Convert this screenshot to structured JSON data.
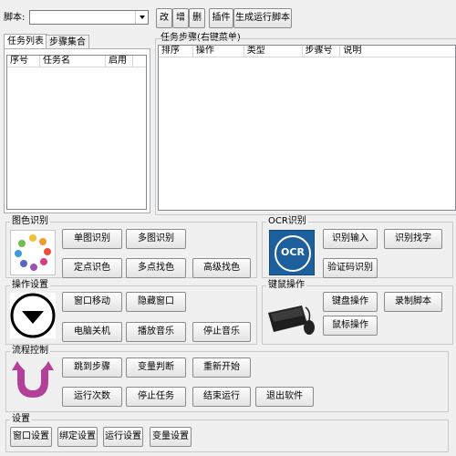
{
  "toolbar": {
    "script_label": "脚本:",
    "script_select_value": "",
    "btn_edit": "改",
    "btn_add": "增",
    "btn_delete": "删",
    "btn_plugin": "插件",
    "btn_generate": "生成运行脚本"
  },
  "left_tabs": {
    "task_list": "任务列表",
    "step_set": "步骤集合"
  },
  "task_list": {
    "columns": [
      "序号",
      "任务名",
      "启用"
    ]
  },
  "task_steps": {
    "title": "任务步骤(右键菜单)",
    "columns": [
      "排序",
      "操作",
      "类型",
      "步骤号",
      "说明"
    ]
  },
  "color_group": {
    "title": "图色识别",
    "buttons": [
      "单图识别",
      "多图识别",
      "定点识色",
      "多点找色",
      "高级找色"
    ]
  },
  "ocr_group": {
    "title": "OCR识别",
    "icon_text": "OCR",
    "buttons": [
      "识别输入",
      "识别找字",
      "验证码识别"
    ]
  },
  "op_group": {
    "title": "操作设置",
    "buttons": [
      "窗口移动",
      "隐藏窗口",
      "电脑关机",
      "播放音乐",
      "停止音乐"
    ]
  },
  "km_group": {
    "title": "键鼠操作",
    "buttons": [
      "键盘操作",
      "录制脚本",
      "鼠标操作"
    ]
  },
  "flow_group": {
    "title": "流程控制",
    "buttons": [
      "跳到步骤",
      "变量判断",
      "重新开始",
      "运行次数",
      "停止任务",
      "结束运行",
      "退出软件"
    ]
  },
  "settings_group": {
    "title": "设置",
    "buttons": [
      "窗口设置",
      "绑定设置",
      "运行设置",
      "变量设置"
    ]
  },
  "colors": {
    "accent_blue": "#1d5f9c",
    "flow_purple": "#b23f98"
  }
}
